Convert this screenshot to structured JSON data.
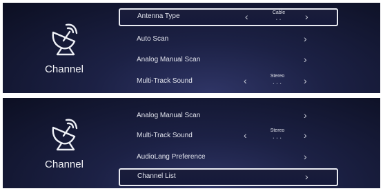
{
  "screens": [
    {
      "category": {
        "label": "Channel",
        "icon": "satellite-dish-icon"
      },
      "items": [
        {
          "label": "Antenna Type",
          "value": "Cable",
          "dots": "• •",
          "arrow_left": "‹",
          "arrow_right": "›",
          "selected": true
        },
        {
          "label": "Auto Scan",
          "arrow_right": "›"
        },
        {
          "label": "Analog Manual Scan",
          "arrow_right": "›"
        },
        {
          "label": "Multi-Track Sound",
          "value": "Stereo",
          "dots": "• • •",
          "arrow_left": "‹",
          "arrow_right": "›"
        }
      ]
    },
    {
      "category": {
        "label": "Channel",
        "icon": "satellite-dish-icon"
      },
      "items": [
        {
          "label": "Analog Manual Scan",
          "arrow_right": "›"
        },
        {
          "label": "Multi-Track Sound",
          "value": "Stereo",
          "dots": "• • •",
          "arrow_left": "‹",
          "arrow_right": "›"
        },
        {
          "label": "AudioLang Preference",
          "arrow_right": "›"
        },
        {
          "label": "Channel List",
          "arrow_right": "›",
          "selected": true
        }
      ]
    }
  ],
  "colors": {
    "background": "#0c0f22",
    "text": "#e3e5ee",
    "selection_border": "#e9ebf2"
  }
}
